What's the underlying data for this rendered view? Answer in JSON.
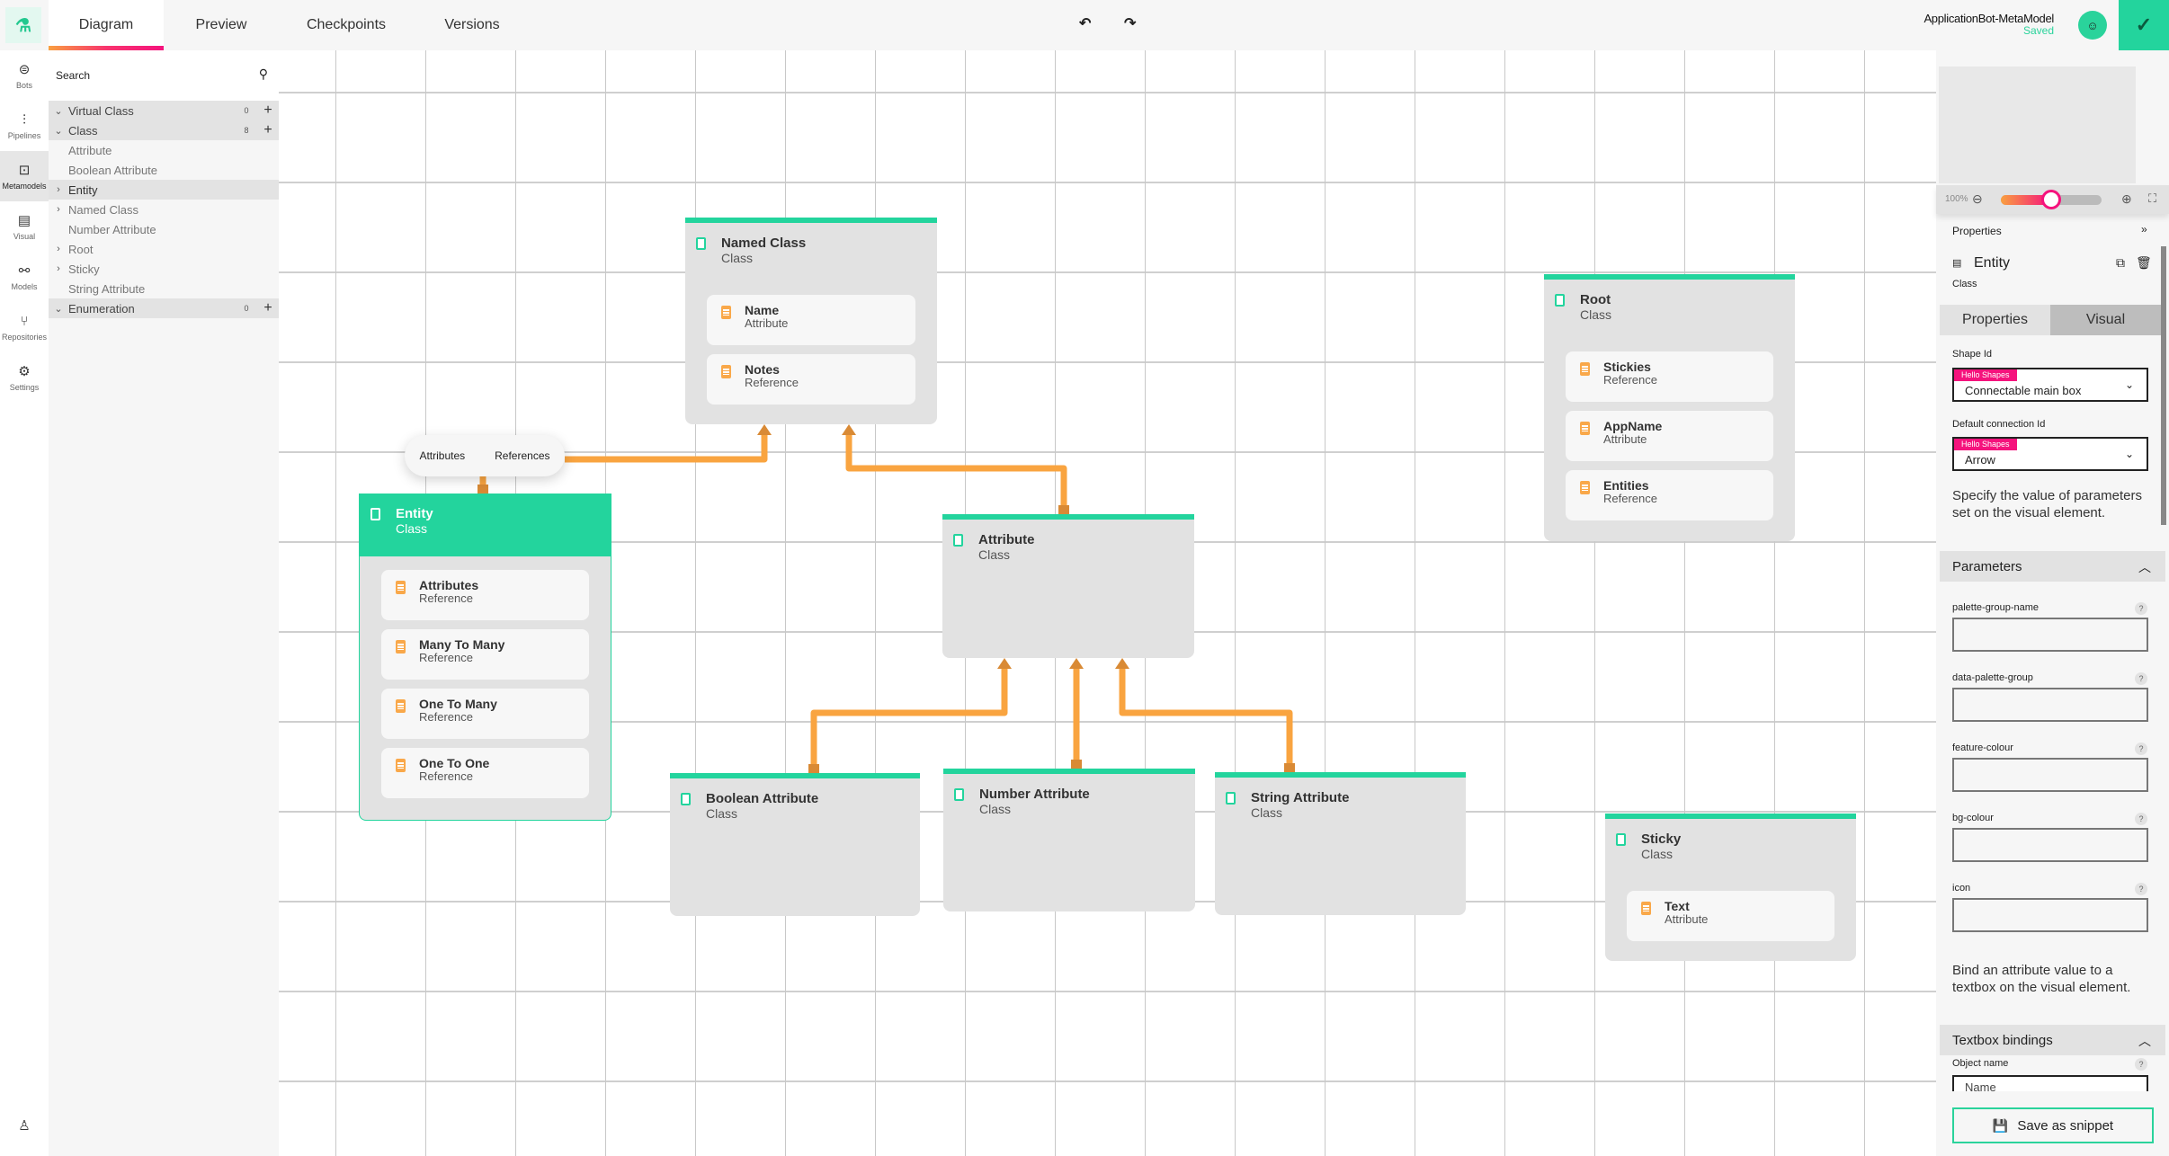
{
  "app": {
    "logo_icon": "flask-icon",
    "tabs": [
      {
        "label": "Diagram",
        "active": true
      },
      {
        "label": "Preview",
        "active": false
      },
      {
        "label": "Checkpoints",
        "active": false
      },
      {
        "label": "Versions",
        "active": false
      }
    ],
    "undo_icon": "undo-icon",
    "redo_icon": "redo-icon",
    "project_name": "ApplicationBot-MetaModel",
    "save_status": "Saved",
    "avatar_icon": "bot-avatar",
    "confirm_icon": "check-circle-icon",
    "accent_color": "#23d49d",
    "highlight_color": "#f5137d"
  },
  "rail": {
    "items": [
      {
        "label": "Bots",
        "icon": "bot-icon",
        "active": false
      },
      {
        "label": "Pipelines",
        "icon": "pipeline-icon",
        "active": false
      },
      {
        "label": "Metamodels",
        "icon": "metamodel-icon",
        "active": true
      },
      {
        "label": "Visual",
        "icon": "visual-icon",
        "active": false
      },
      {
        "label": "Models",
        "icon": "models-icon",
        "active": false
      },
      {
        "label": "Repositories",
        "icon": "branch-icon",
        "active": false
      },
      {
        "label": "Settings",
        "icon": "gears-icon",
        "active": false
      }
    ],
    "account_icon": "user-icon"
  },
  "explorer": {
    "search_placeholder": "Search",
    "tree": [
      {
        "label": "Virtual Class",
        "kind": "group",
        "expanded": true,
        "count": "0"
      },
      {
        "label": "Class",
        "kind": "group",
        "expanded": true,
        "count": "8"
      },
      {
        "label": "Attribute",
        "kind": "item",
        "hasChildren": false
      },
      {
        "label": "Boolean Attribute",
        "kind": "item",
        "hasChildren": false
      },
      {
        "label": "Entity",
        "kind": "item",
        "hasChildren": true,
        "selected": true
      },
      {
        "label": "Named Class",
        "kind": "item",
        "hasChildren": true
      },
      {
        "label": "Number Attribute",
        "kind": "item",
        "hasChildren": false
      },
      {
        "label": "Root",
        "kind": "item",
        "hasChildren": true
      },
      {
        "label": "Sticky",
        "kind": "item",
        "hasChildren": true
      },
      {
        "label": "String Attribute",
        "kind": "item",
        "hasChildren": false
      },
      {
        "label": "Enumeration",
        "kind": "group",
        "expanded": true,
        "count": "0"
      }
    ]
  },
  "diagram": {
    "connector_pill": {
      "left": "Attributes",
      "right": "References"
    },
    "nodes": {
      "named_class": {
        "title": "Named Class",
        "type": "Class",
        "features": [
          {
            "name": "Name",
            "type": "Attribute"
          },
          {
            "name": "Notes",
            "type": "Reference"
          }
        ]
      },
      "entity": {
        "title": "Entity",
        "type": "Class",
        "features": [
          {
            "name": "Attributes",
            "type": "Reference"
          },
          {
            "name": "Many To Many",
            "type": "Reference"
          },
          {
            "name": "One To Many",
            "type": "Reference"
          },
          {
            "name": "One To One",
            "type": "Reference"
          }
        ]
      },
      "attribute": {
        "title": "Attribute",
        "type": "Class",
        "features": []
      },
      "root": {
        "title": "Root",
        "type": "Class",
        "features": [
          {
            "name": "Stickies",
            "type": "Reference"
          },
          {
            "name": "AppName",
            "type": "Attribute"
          },
          {
            "name": "Entities",
            "type": "Reference"
          }
        ]
      },
      "boolean_attribute": {
        "title": "Boolean Attribute",
        "type": "Class",
        "features": []
      },
      "number_attribute": {
        "title": "Number Attribute",
        "type": "Class",
        "features": []
      },
      "string_attribute": {
        "title": "String Attribute",
        "type": "Class",
        "features": []
      },
      "sticky": {
        "title": "Sticky",
        "type": "Class",
        "features": [
          {
            "name": "Text",
            "type": "Attribute"
          }
        ]
      }
    },
    "connections": [
      {
        "from": "entity",
        "to": "named_class"
      },
      {
        "from": "attribute",
        "to": "named_class"
      },
      {
        "from": "boolean_attribute",
        "to": "attribute"
      },
      {
        "from": "number_attribute",
        "to": "attribute"
      },
      {
        "from": "string_attribute",
        "to": "attribute"
      }
    ],
    "wire_color": "#f9a440"
  },
  "minimap": {
    "zoom_label": "100%",
    "zoom_fraction": 0.5
  },
  "properties": {
    "header": "Properties",
    "collapse_icon": "double-chevron-right-icon",
    "selected_name": "Entity",
    "selected_type": "Class",
    "tabs": [
      {
        "label": "Properties",
        "active": false
      },
      {
        "label": "Visual",
        "active": true
      }
    ],
    "shape_id_label": "Shape Id",
    "shape_id_tag": "Hello Shapes",
    "shape_id_value": "Connectable main box",
    "connection_id_label": "Default connection Id",
    "connection_id_tag": "Hello Shapes",
    "connection_id_value": "Arrow",
    "params_help": "Specify the value of parameters set on the visual element.",
    "parameters_title": "Parameters",
    "parameters": [
      {
        "name": "palette-group-name",
        "value": ""
      },
      {
        "name": "data-palette-group",
        "value": ""
      },
      {
        "name": "feature-colour",
        "value": ""
      },
      {
        "name": "bg-colour",
        "value": ""
      },
      {
        "name": "icon",
        "value": ""
      }
    ],
    "bindings_help": "Bind an attribute value to a textbox on the visual element.",
    "bindings_title": "Textbox bindings",
    "object_name_label": "Object name",
    "object_name_value": "Name",
    "save_snippet_label": "Save as snippet"
  }
}
